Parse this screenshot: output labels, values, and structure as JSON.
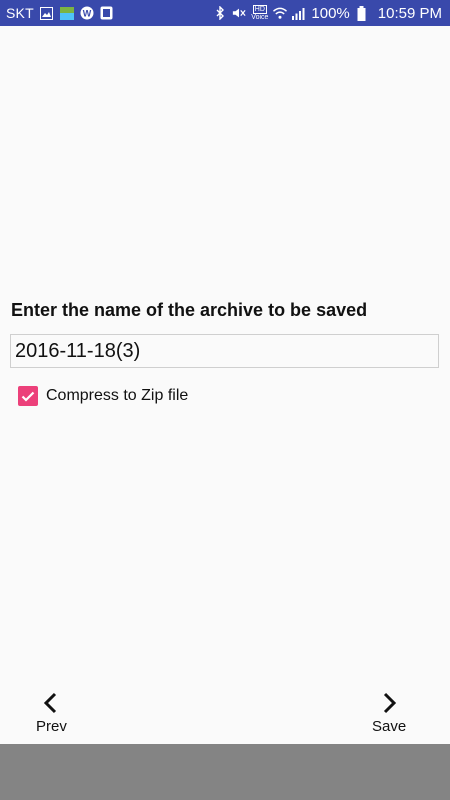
{
  "status_bar": {
    "carrier": "SKT",
    "voice_label": "Voice",
    "hd_label": "HD",
    "battery": "100%",
    "time": "10:59 PM",
    "background": "#3949ab"
  },
  "main": {
    "prompt": "Enter the name of the archive to be saved",
    "archive_name": "2016-11-18(3)",
    "compress": {
      "label": "Compress to Zip file",
      "checked": true,
      "color": "#ec407a"
    }
  },
  "nav": {
    "prev_label": "Prev",
    "save_label": "Save"
  }
}
